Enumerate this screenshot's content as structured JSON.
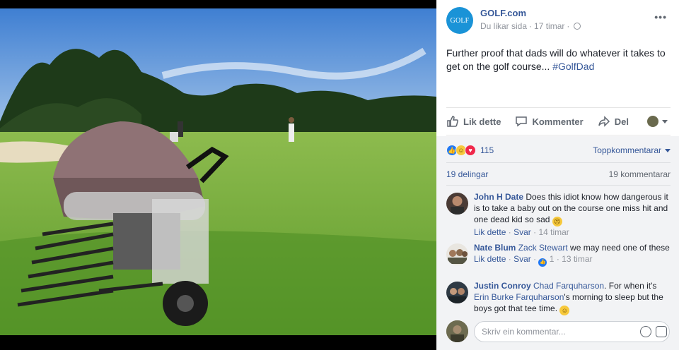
{
  "post": {
    "page_name": "GOLF.com",
    "logo_text": "GOLF",
    "meta_liked": "Du likar sida",
    "meta_dot": "·",
    "meta_time": "17 timar",
    "meta_dot2": "·",
    "more": "•••",
    "text_main": "Further proof that dads will do whatever it takes to get on the golf course... ",
    "text_hashtag": "#GolfDad"
  },
  "actions": {
    "like": "Lik dette",
    "comment": "Kommenter",
    "share": "Del"
  },
  "reactions": {
    "count": "115",
    "top_comments": "Toppkommentarar"
  },
  "stats": {
    "shares": "19 delingar",
    "comments": "19 kommentarar"
  },
  "comments": [
    {
      "name": "John H Date",
      "text": " Does this idiot know how dangerous it is to take a baby out on the course one miss hit and one dead kid so sad ",
      "emoji": "☹",
      "like": "Lik dette",
      "dot": "·",
      "reply": "Svar",
      "dot2": "·",
      "time": "14 timar"
    },
    {
      "name": "Nate Blum",
      "mention": "Zack Stewart",
      "text": " we may need one of these",
      "like": "Lik dette",
      "dot": "·",
      "reply": "Svar",
      "dot2": "·",
      "likes": "1",
      "dot3": "·",
      "time": "13 timar"
    },
    {
      "name": "Justin Conroy",
      "mention": "Chad Farquharson",
      "text": ". For when it's ",
      "mention2": "Erin Burke Farquharson",
      "text2": "'s morning to sleep but the boys got that tee time. ",
      "emoji": "☺"
    }
  ],
  "input": {
    "placeholder": "Skriv ein kommentar..."
  },
  "colors": {
    "link": "#365899",
    "like_blue": "#2078f4",
    "panel_gray": "#f2f3f5"
  }
}
